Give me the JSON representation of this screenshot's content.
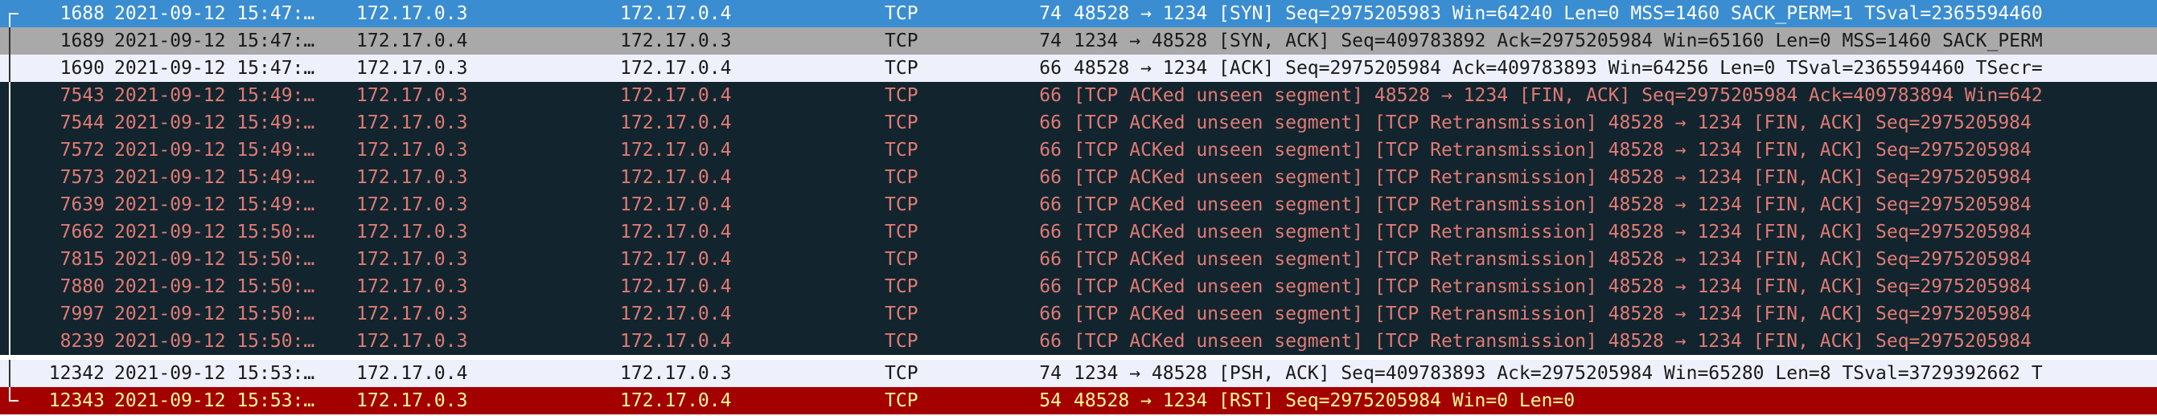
{
  "packets": [
    {
      "no": "1688",
      "time": "2021-09-12 15:47:…",
      "src": "172.17.0.3",
      "dst": "172.17.0.4",
      "proto": "TCP",
      "len": "74",
      "info": "48528 → 1234 [SYN] Seq=2975205983 Win=64240 Len=0 MSS=1460 SACK_PERM=1 TSval=2365594460",
      "style": "selected"
    },
    {
      "no": "1689",
      "time": "2021-09-12 15:47:…",
      "src": "172.17.0.4",
      "dst": "172.17.0.3",
      "proto": "TCP",
      "len": "74",
      "info": "1234 → 48528 [SYN, ACK] Seq=409783892 Ack=2975205984 Win=65160 Len=0 MSS=1460 SACK_PERM",
      "style": "gray"
    },
    {
      "no": "1690",
      "time": "2021-09-12 15:47:…",
      "src": "172.17.0.3",
      "dst": "172.17.0.4",
      "proto": "TCP",
      "len": "66",
      "info": "48528 → 1234 [ACK] Seq=2975205984 Ack=409783893 Win=64256 Len=0 TSval=2365594460 TSecr=",
      "style": "light"
    },
    {
      "no": "7543",
      "time": "2021-09-12 15:49:…",
      "src": "172.17.0.3",
      "dst": "172.17.0.4",
      "proto": "TCP",
      "len": "66",
      "info": "[TCP ACKed unseen segment] 48528 → 1234 [FIN, ACK] Seq=2975205984 Ack=409783894 Win=642",
      "style": "bad"
    },
    {
      "no": "7544",
      "time": "2021-09-12 15:49:…",
      "src": "172.17.0.3",
      "dst": "172.17.0.4",
      "proto": "TCP",
      "len": "66",
      "info": "[TCP ACKed unseen segment] [TCP Retransmission] 48528 → 1234 [FIN, ACK] Seq=2975205984",
      "style": "bad"
    },
    {
      "no": "7572",
      "time": "2021-09-12 15:49:…",
      "src": "172.17.0.3",
      "dst": "172.17.0.4",
      "proto": "TCP",
      "len": "66",
      "info": "[TCP ACKed unseen segment] [TCP Retransmission] 48528 → 1234 [FIN, ACK] Seq=2975205984",
      "style": "bad"
    },
    {
      "no": "7573",
      "time": "2021-09-12 15:49:…",
      "src": "172.17.0.3",
      "dst": "172.17.0.4",
      "proto": "TCP",
      "len": "66",
      "info": "[TCP ACKed unseen segment] [TCP Retransmission] 48528 → 1234 [FIN, ACK] Seq=2975205984",
      "style": "bad"
    },
    {
      "no": "7639",
      "time": "2021-09-12 15:49:…",
      "src": "172.17.0.3",
      "dst": "172.17.0.4",
      "proto": "TCP",
      "len": "66",
      "info": "[TCP ACKed unseen segment] [TCP Retransmission] 48528 → 1234 [FIN, ACK] Seq=2975205984",
      "style": "bad"
    },
    {
      "no": "7662",
      "time": "2021-09-12 15:50:…",
      "src": "172.17.0.3",
      "dst": "172.17.0.4",
      "proto": "TCP",
      "len": "66",
      "info": "[TCP ACKed unseen segment] [TCP Retransmission] 48528 → 1234 [FIN, ACK] Seq=2975205984",
      "style": "bad"
    },
    {
      "no": "7815",
      "time": "2021-09-12 15:50:…",
      "src": "172.17.0.3",
      "dst": "172.17.0.4",
      "proto": "TCP",
      "len": "66",
      "info": "[TCP ACKed unseen segment] [TCP Retransmission] 48528 → 1234 [FIN, ACK] Seq=2975205984",
      "style": "bad"
    },
    {
      "no": "7880",
      "time": "2021-09-12 15:50:…",
      "src": "172.17.0.3",
      "dst": "172.17.0.4",
      "proto": "TCP",
      "len": "66",
      "info": "[TCP ACKed unseen segment] [TCP Retransmission] 48528 → 1234 [FIN, ACK] Seq=2975205984",
      "style": "bad"
    },
    {
      "no": "7997",
      "time": "2021-09-12 15:50:…",
      "src": "172.17.0.3",
      "dst": "172.17.0.4",
      "proto": "TCP",
      "len": "66",
      "info": "[TCP ACKed unseen segment] [TCP Retransmission] 48528 → 1234 [FIN, ACK] Seq=2975205984",
      "style": "bad"
    },
    {
      "no": "8239",
      "time": "2021-09-12 15:50:…",
      "src": "172.17.0.3",
      "dst": "172.17.0.4",
      "proto": "TCP",
      "len": "66",
      "info": "[TCP ACKed unseen segment] [TCP Retransmission] 48528 → 1234 [FIN, ACK] Seq=2975205984",
      "style": "bad"
    },
    {
      "no": "12342",
      "time": "2021-09-12 15:53:…",
      "src": "172.17.0.4",
      "dst": "172.17.0.3",
      "proto": "TCP",
      "len": "74",
      "info": "1234 → 48528 [PSH, ACK] Seq=409783893 Ack=2975205984 Win=65280 Len=8 TSval=3729392662 T",
      "style": "light"
    },
    {
      "no": "12343",
      "time": "2021-09-12 15:53:…",
      "src": "172.17.0.3",
      "dst": "172.17.0.4",
      "proto": "TCP",
      "len": "54",
      "info": "48528 → 1234 [RST] Seq=2975205984 Win=0 Len=0",
      "style": "rst"
    }
  ]
}
